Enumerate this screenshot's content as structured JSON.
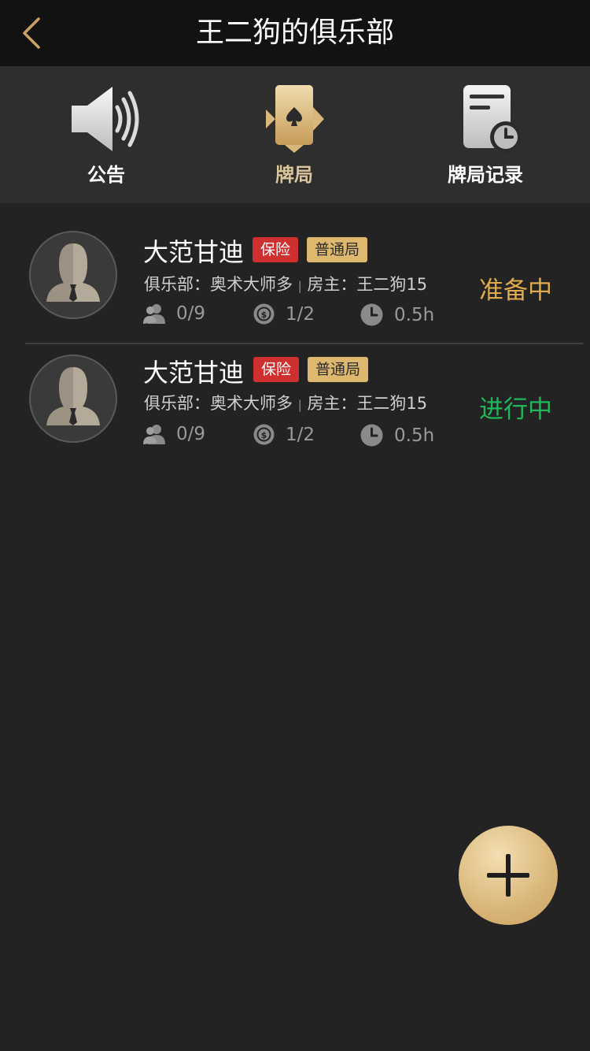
{
  "header": {
    "title": "王二狗的俱乐部"
  },
  "tabs": [
    {
      "label": "公告",
      "icon": "speaker-icon"
    },
    {
      "label": "牌局",
      "icon": "card-icon",
      "active": true
    },
    {
      "label": "牌局记录",
      "icon": "record-icon"
    }
  ],
  "games": [
    {
      "name": "大范甘迪",
      "tag_insurance": "保险",
      "tag_type": "普通局",
      "club_label": "俱乐部：奥术大师多",
      "separator": "|",
      "owner_label": "房主：王二狗15",
      "players": "0/9",
      "blinds": "1/2",
      "duration": "0.5h",
      "status": "准备中",
      "status_color": "#e0ab4c"
    },
    {
      "name": "大范甘迪",
      "tag_insurance": "保险",
      "tag_type": "普通局",
      "club_label": "俱乐部：奥术大师多",
      "separator": "|",
      "owner_label": "房主：王二狗15",
      "players": "0/9",
      "blinds": "1/2",
      "duration": "0.5h",
      "status": "进行中",
      "status_color": "#1fb85a"
    }
  ],
  "colors": {
    "accent": "#dcc59a",
    "background": "#232323",
    "header": "#121212"
  }
}
